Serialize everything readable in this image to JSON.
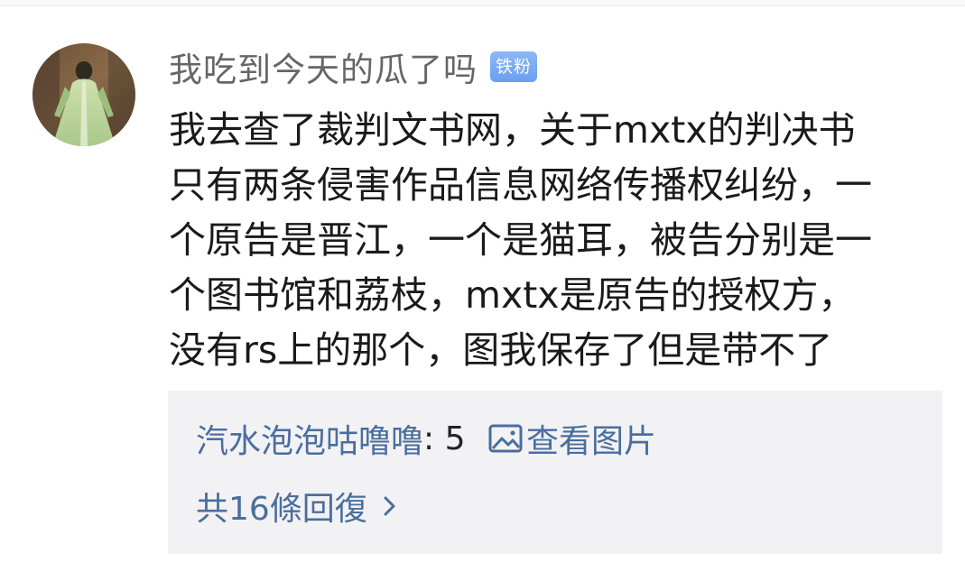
{
  "post": {
    "username": "我吃到今天的瓜了吗",
    "badge": "铁粉",
    "content_lines": [
      "我去查了裁判文书网，关于mxtx的判决书",
      "只有两条侵害作品信息网络传播权纠纷，一",
      "个原告是晋江，一个是猫耳，被告分别是一",
      "个图书馆和荔枝，mxtx是原告的授权方，",
      "没有rs上的那个，图我保存了但是带不了"
    ]
  },
  "reply_box": {
    "preview_author": "汽水泡泡咕噜噜",
    "preview_text": ": 5 ",
    "view_image_label": "查看图片",
    "view_image_icon": "image-icon",
    "reply_count_label": "共16條回復",
    "reply_count_icon": "chevron-right-icon"
  },
  "colors": {
    "username": "#666666",
    "badge_bg": "#7aa9f3",
    "link": "#4a6e9e",
    "reply_bg": "#f2f2f4",
    "body_text": "#1a1a1a"
  }
}
